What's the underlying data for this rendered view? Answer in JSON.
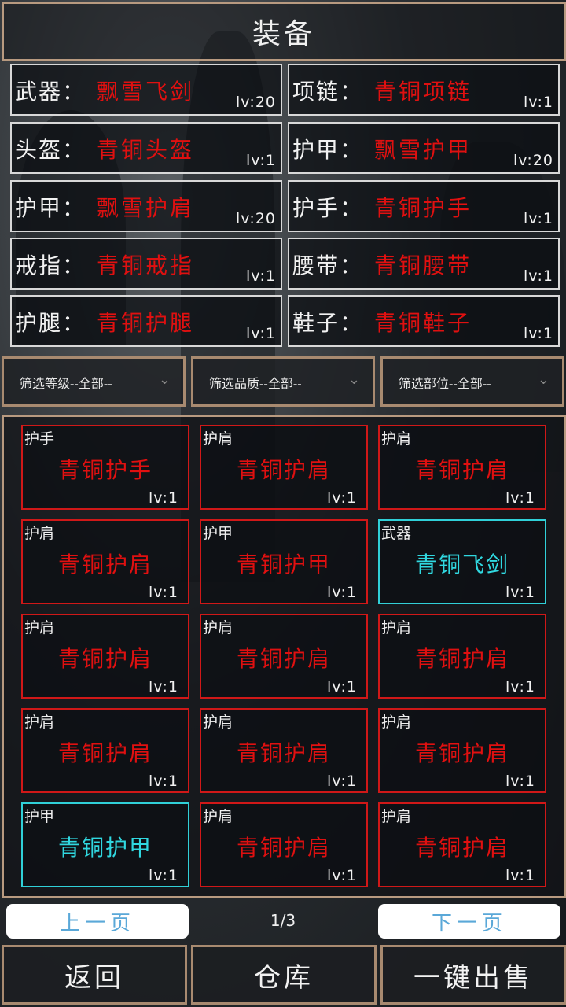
{
  "title": "装备",
  "equipped": [
    {
      "label": "武器：",
      "name": "飘雪飞剑",
      "level": "lv:20"
    },
    {
      "label": "项链：",
      "name": "青铜项链",
      "level": "lv:1"
    },
    {
      "label": "头盔：",
      "name": "青铜头盔",
      "level": "lv:1"
    },
    {
      "label": "护甲：",
      "name": "飘雪护甲",
      "level": "lv:20"
    },
    {
      "label": "护甲：",
      "name": "飘雪护肩",
      "level": "lv:20"
    },
    {
      "label": "护手：",
      "name": "青铜护手",
      "level": "lv:1"
    },
    {
      "label": "戒指：",
      "name": "青铜戒指",
      "level": "lv:1"
    },
    {
      "label": "腰带：",
      "name": "青铜腰带",
      "level": "lv:1"
    },
    {
      "label": "护腿：",
      "name": "青铜护腿",
      "level": "lv:1"
    },
    {
      "label": "鞋子：",
      "name": "青铜鞋子",
      "level": "lv:1"
    }
  ],
  "filters": [
    {
      "label": "筛选等级--全部--"
    },
    {
      "label": "筛选品质--全部--"
    },
    {
      "label": "筛选部位--全部--"
    }
  ],
  "inventory": [
    {
      "type": "护手",
      "name": "青铜护手",
      "level": "lv:1",
      "quality": "red"
    },
    {
      "type": "护肩",
      "name": "青铜护肩",
      "level": "lv:1",
      "quality": "red"
    },
    {
      "type": "护肩",
      "name": "青铜护肩",
      "level": "lv:1",
      "quality": "red"
    },
    {
      "type": "护肩",
      "name": "青铜护肩",
      "level": "lv:1",
      "quality": "red"
    },
    {
      "type": "护甲",
      "name": "青铜护甲",
      "level": "lv:1",
      "quality": "red"
    },
    {
      "type": "武器",
      "name": "青铜飞剑",
      "level": "lv:1",
      "quality": "cyan"
    },
    {
      "type": "护肩",
      "name": "青铜护肩",
      "level": "lv:1",
      "quality": "red"
    },
    {
      "type": "护肩",
      "name": "青铜护肩",
      "level": "lv:1",
      "quality": "red"
    },
    {
      "type": "护肩",
      "name": "青铜护肩",
      "level": "lv:1",
      "quality": "red"
    },
    {
      "type": "护肩",
      "name": "青铜护肩",
      "level": "lv:1",
      "quality": "red"
    },
    {
      "type": "护肩",
      "name": "青铜护肩",
      "level": "lv:1",
      "quality": "red"
    },
    {
      "type": "护肩",
      "name": "青铜护肩",
      "level": "lv:1",
      "quality": "red"
    },
    {
      "type": "护甲",
      "name": "青铜护甲",
      "level": "lv:1",
      "quality": "cyan"
    },
    {
      "type": "护肩",
      "name": "青铜护肩",
      "level": "lv:1",
      "quality": "red"
    },
    {
      "type": "护肩",
      "name": "青铜护肩",
      "level": "lv:1",
      "quality": "red"
    }
  ],
  "pagination": {
    "prev": "上一页",
    "next": "下一页",
    "indicator": "1/3"
  },
  "actions": {
    "back": "返回",
    "warehouse": "仓库",
    "sell_all": "一键出售"
  },
  "colors": {
    "red_quality": "#e01010",
    "cyan_quality": "#30d8e0",
    "frame": "#b89a80"
  }
}
